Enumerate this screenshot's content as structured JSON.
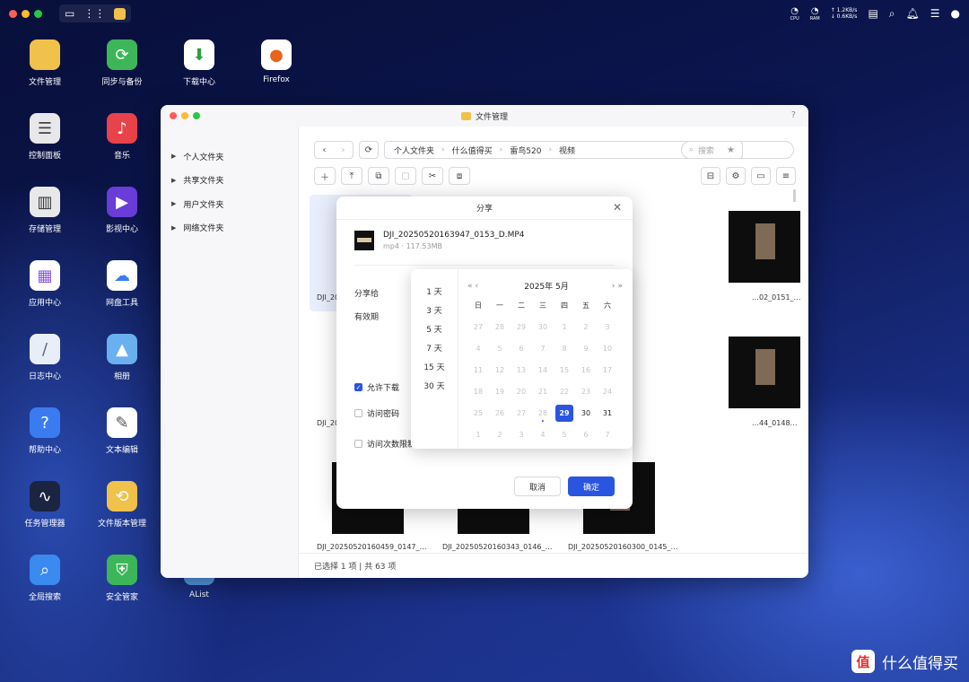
{
  "colors": {
    "accent": "#2a55e0",
    "tl_red": "#ff5f57",
    "tl_yellow": "#febc2e",
    "tl_green": "#28c840"
  },
  "topbar": {
    "cpu_label": "CPU",
    "ram_label": "RAM",
    "net_up": "↑ 1.2KB/s",
    "net_down": "↓ 0.6KB/s"
  },
  "desktop": [
    {
      "label": "文件管理",
      "icon": "folder-icon",
      "color": "#f0c24b"
    },
    {
      "label": "同步与备份",
      "icon": "sync-icon",
      "color": "#3db65a"
    },
    {
      "label": "下载中心",
      "icon": "download-icon",
      "color": "#ffffff"
    },
    {
      "label": "Firefox",
      "icon": "firefox-icon",
      "color": "#ffffff"
    },
    {
      "label": "控制面板",
      "icon": "control-panel-icon",
      "color": "#e8e8ea"
    },
    {
      "label": "音乐",
      "icon": "music-icon",
      "color": "#e8424a"
    },
    {
      "label": "存储管理",
      "icon": "storage-icon",
      "color": "#e8e8ea"
    },
    {
      "label": "影视中心",
      "icon": "video-icon",
      "color": "#6a3cd8"
    },
    {
      "label": "应用中心",
      "icon": "app-center-icon",
      "color": "#ffffff"
    },
    {
      "label": "网盘工具",
      "icon": "cloud-drive-icon",
      "color": "#ffffff"
    },
    {
      "label": "日志中心",
      "icon": "logs-icon",
      "color": "#e8eef8"
    },
    {
      "label": "相册",
      "icon": "photos-icon",
      "color": "#6ab0f0"
    },
    {
      "label": "帮助中心",
      "icon": "help-icon",
      "color": "#3a7cf0"
    },
    {
      "label": "文本编辑",
      "icon": "text-editor-icon",
      "color": "#ffffff"
    },
    {
      "label": "任务管理器",
      "icon": "task-manager-icon",
      "color": "#1b2440"
    },
    {
      "label": "文件版本管理",
      "icon": "file-version-icon",
      "color": "#f0c24b"
    },
    {
      "label": "全局搜索",
      "icon": "global-search-icon",
      "color": "#3a8af0"
    },
    {
      "label": "安全管家",
      "icon": "security-icon",
      "color": "#3db65a"
    },
    {
      "label": "AList",
      "icon": "alist-icon",
      "color": "#5aa0f0"
    }
  ],
  "window": {
    "title": "文件管理",
    "help": "?",
    "sidebar": [
      "个人文件夹",
      "共享文件夹",
      "用户文件夹",
      "网络文件夹"
    ],
    "path": [
      "个人文件夹",
      "什么值得买",
      "雷鸟520",
      "视频"
    ],
    "search_placeholder": "搜索",
    "status": "已选择 1 项 | 共 63 项",
    "files": [
      {
        "name": "DJI_20…"
      },
      {
        "name": "…02_0151_…"
      },
      {
        "name": "DJI_20…"
      },
      {
        "name": "…44_0148…"
      },
      {
        "name": "DJI_20250520160459_0147_…"
      },
      {
        "name": "DJI_20250520160343_0146_…"
      },
      {
        "name": "DJI_20250520160300_0145_…"
      }
    ]
  },
  "dialog": {
    "title": "分享",
    "file_name": "DJI_20250520163947_0153_D.MP4",
    "file_meta": "mp4 · 117.53MB",
    "share_to": "分享给",
    "validity": "有效期",
    "allow_download": "允许下载",
    "access_password": "访问密码",
    "access_limit": "访问次数限制",
    "cancel": "取消",
    "ok": "确定"
  },
  "datepicker": {
    "quick": [
      "1 天",
      "3 天",
      "5 天",
      "7 天",
      "15 天",
      "30 天"
    ],
    "month": "2025年 5月",
    "weekdays": [
      "日",
      "一",
      "二",
      "三",
      "四",
      "五",
      "六"
    ],
    "days": [
      "27",
      "28",
      "29",
      "30",
      "1",
      "2",
      "3",
      "4",
      "5",
      "6",
      "7",
      "8",
      "9",
      "10",
      "11",
      "12",
      "13",
      "14",
      "15",
      "16",
      "17",
      "18",
      "19",
      "20",
      "21",
      "22",
      "23",
      "24",
      "25",
      "26",
      "27",
      "28",
      "29",
      "30",
      "31",
      "1",
      "2",
      "3",
      "4",
      "5",
      "6",
      "7"
    ],
    "selected": "29"
  },
  "watermark": {
    "text": "什么值得买",
    "logo": "值"
  }
}
